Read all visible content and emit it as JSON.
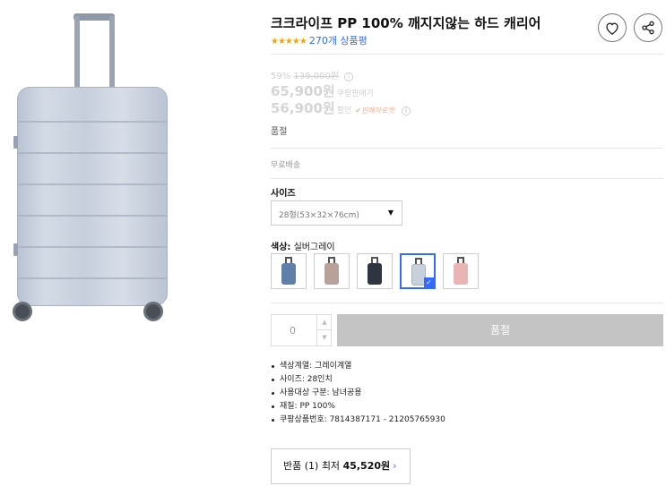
{
  "product": {
    "title": "크크라이프 PP 100% 깨지지않는 하드 캐리어",
    "stars": "★★★★★",
    "review_count": "270개 상품평",
    "rating_value": 5
  },
  "actions": {
    "wishlist_icon": "heart-icon",
    "share_icon": "share-icon"
  },
  "pricing": {
    "discount_rate": "59%",
    "original_price": "139,000원",
    "info_mark": "i",
    "sale_price": "65,900원",
    "sale_label": "쿠팡판매가",
    "coupon_price": "56,900원",
    "coupon_label": "할인",
    "coupon_badge": "✔판매자로켓",
    "coupon_info_mark": "i"
  },
  "status": {
    "soldout_text": "품절",
    "shipping_text": "무료배송"
  },
  "size": {
    "label": "사이즈",
    "selected": "28형(53×32×76cm)",
    "caret": "▼"
  },
  "color": {
    "label_prefix": "색상:",
    "selected_name": "실버그레이",
    "swatches": [
      {
        "name": "blue",
        "color": "#5d7fa8",
        "selected": false
      },
      {
        "name": "rose-brown",
        "color": "#b8a199",
        "selected": false
      },
      {
        "name": "black",
        "color": "#2e3440",
        "selected": false
      },
      {
        "name": "silver-gray",
        "color": "#c8d0dc",
        "selected": true
      },
      {
        "name": "pink",
        "color": "#e8b4b4",
        "selected": false
      }
    ],
    "check_mark": "✓"
  },
  "purchase": {
    "quantity": "0",
    "qty_up": "▲",
    "qty_down": "▼",
    "button_label": "품절"
  },
  "attributes": [
    "색상계열: 그레이계열",
    "사이즈: 28인치",
    "사용대상 구분: 남녀공용",
    "재질: PP 100%",
    "쿠팡상품번호: 7814387171 - 21205765930"
  ],
  "returns": {
    "prefix": "반품 (1) 최저",
    "price": "45,520원",
    "chevron": "›"
  },
  "colors": {
    "accent": "#346aff",
    "star": "#f5a500",
    "soldout_button": "#c4c4c4"
  }
}
